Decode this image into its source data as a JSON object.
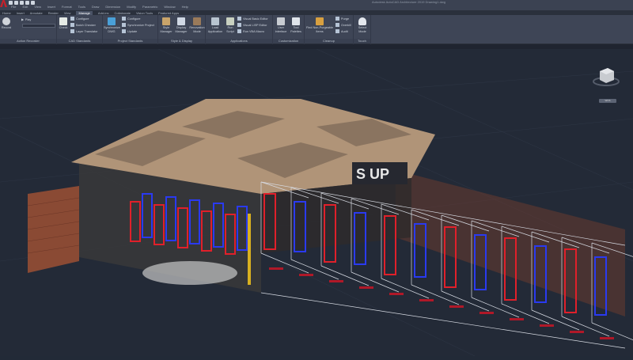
{
  "title": "Autodesk AutoCAD Architecture 2019  Drawing1.dwg",
  "menu": [
    "File",
    "Edit",
    "View",
    "Insert",
    "Format",
    "Tools",
    "Draw",
    "Dimension",
    "Modify",
    "Parametric",
    "Window",
    "Help"
  ],
  "tabs": [
    "Home",
    "Insert",
    "Annotate",
    "Render",
    "View",
    "Manage",
    "Add-ins",
    "Collaborate",
    "Vision Tools",
    "Featured Apps"
  ],
  "active_tab": "Manage",
  "panels": {
    "action_recorder": {
      "label": "Action Recorder",
      "record": "Record",
      "play": "Play"
    },
    "cad_standards": {
      "label": "CAD Standards",
      "check": "Check",
      "configure": "Configure",
      "batch_checker": "Batch Checker",
      "layer_translator": "Layer Translator"
    },
    "project_standards": {
      "label": "Project Standards",
      "sync": "Synchronize DWG",
      "configure": "Configure",
      "sync_project": "Synchronize Project",
      "update": "Update"
    },
    "style_display": {
      "label": "Style & Display",
      "style_manager": "Style Manager",
      "display_manager": "Display Manager",
      "renovation_mode": "Renovation Mode"
    },
    "applications": {
      "label": "Applications",
      "load": "Load Application",
      "run_script": "Run Script",
      "vbe": "Visual Basic Editor",
      "vlisp": "Visual LISP Editor",
      "vba": "Run VBA Macro"
    },
    "customization": {
      "label": "Customization",
      "ui": "User Interface",
      "tool_palettes": "Tool Palettes"
    },
    "cleanup": {
      "label": "Cleanup",
      "find": "Find Non-Purgeable Items",
      "purge": "Purge",
      "overkill": "Overkill",
      "audit": "Audit"
    },
    "touch": {
      "label": "Touch",
      "select_mode": "Select Mode"
    }
  },
  "viewcube": {
    "wcs": "WCS"
  },
  "sign_text": "S  UP",
  "colors": {
    "ribbon": "#3e4556",
    "viewport": "#232a37",
    "red": "#e0202a",
    "blue": "#2a3af0",
    "wire": "#d8dce4",
    "brick": "#a0553a"
  }
}
